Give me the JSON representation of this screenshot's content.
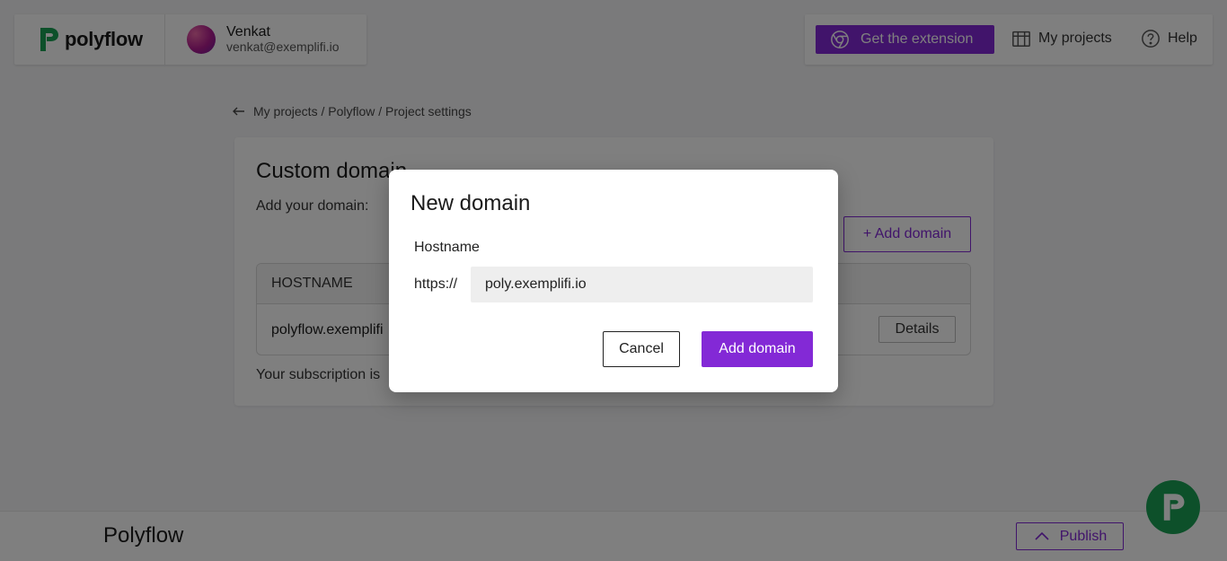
{
  "brand": {
    "name": "polyflow",
    "logo_icon": "polyflow-logo-icon",
    "logo_color": "#1aa055"
  },
  "user": {
    "name": "Venkat",
    "email": "venkat@exemplifi.io"
  },
  "nav": {
    "extension_label": "Get the extension",
    "extension_icon": "chrome-icon",
    "projects_label": "My projects",
    "projects_icon": "gift-icon",
    "help_label": "Help",
    "help_icon": "help-circle-icon"
  },
  "breadcrumb": {
    "text": "My projects / Polyflow / Project settings",
    "icon": "arrow-left-icon"
  },
  "custom_domain": {
    "title": "Custom domain",
    "subtitle": "Add your domain:",
    "add_button": "+ Add domain",
    "table": {
      "header": "HOSTNAME",
      "rows": [
        {
          "hostname": "polyflow.exemplifi",
          "action": "Details"
        }
      ]
    },
    "subscription_text": "Your subscription is"
  },
  "bottom_bar": {
    "title": "Polyflow",
    "publish_label": "Publish",
    "publish_icon": "chevron-up-icon"
  },
  "modal": {
    "title": "New domain",
    "field_label": "Hostname",
    "prefix": "https://",
    "hostname_value": "poly.exemplifi.io",
    "cancel_label": "Cancel",
    "submit_label": "Add domain"
  },
  "colors": {
    "accent": "#8329d6",
    "brand_green": "#1aa055",
    "overlay": "rgba(0,0,0,0.5)"
  }
}
